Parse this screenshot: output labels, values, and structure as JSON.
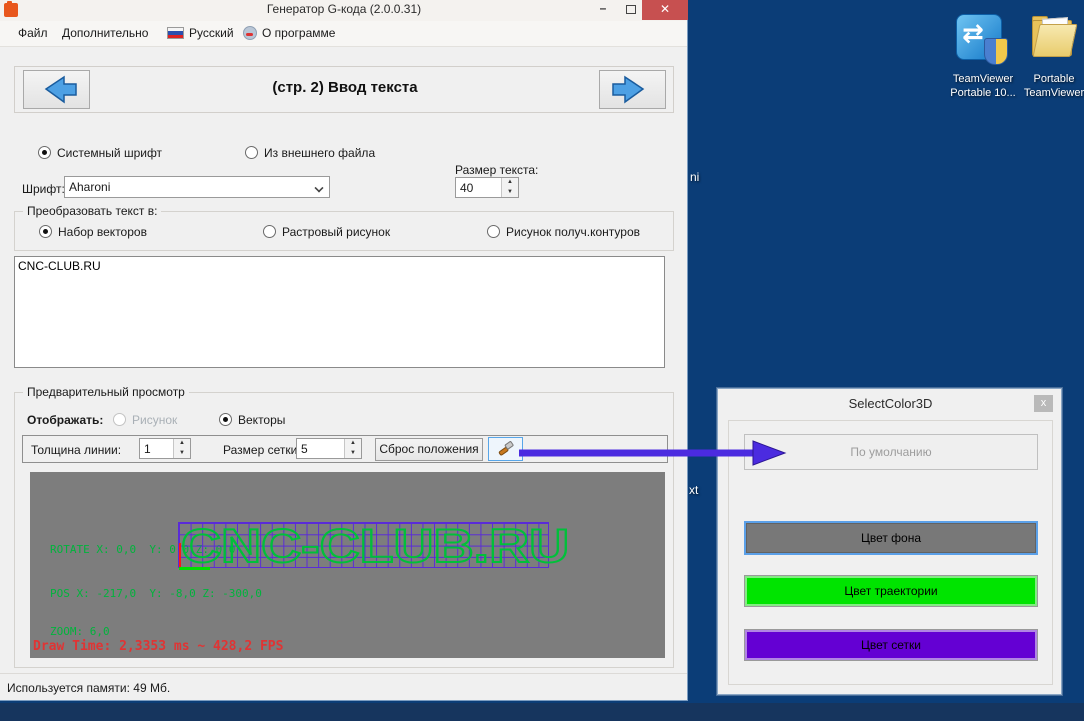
{
  "app": {
    "title": "Генератор G-кода (2.0.0.31)",
    "controls": {
      "minimize": "–",
      "close": "✕"
    }
  },
  "menu": {
    "items": [
      {
        "label": "Файл"
      },
      {
        "label": "Дополнительно"
      },
      {
        "label": "Русский"
      },
      {
        "label": "О программе"
      }
    ]
  },
  "nav": {
    "page_title": "(стр. 2) Ввод текста"
  },
  "font_section": {
    "radio_system": "Системный шрифт",
    "radio_external": "Из внешнего файла",
    "font_label": "Шрифт:",
    "font_value": "Aharoni",
    "size_label": "Размер текста:",
    "size_value": "40"
  },
  "convert_group": {
    "title": "Преобразовать текст в:",
    "option_vectors": "Набор векторов",
    "option_raster": "Растровый рисунок",
    "option_contours": "Рисунок получ.контуров"
  },
  "text_input": {
    "value": "CNC-CLUB.RU"
  },
  "preview": {
    "group_title": "Предварительный просмотр",
    "display_label": "Отображать:",
    "radio_picture": "Рисунок",
    "radio_vectors": "Векторы",
    "line_width_label": "Толщина линии:",
    "line_width_value": "1",
    "grid_size_label": "Размер сетки:",
    "grid_size_value": "5",
    "reset_button": "Сброс положения",
    "canvas": {
      "rotate_text": "ROTATE X: 0,0  Y: 0,0 Z: 0,0",
      "pos_text": "POS X: -217,0  Y: -8,0 Z: -300,0",
      "zoom_text": "ZOOM: 6,0",
      "draw_time_text": "Draw Time: 2,3353 ms ~ 428,2 FPS",
      "vector_text": "CNC-CLUB.RU",
      "bg_color": "#7d7d7d",
      "grid_color": "#5a2bd8",
      "trajectory_color": "#00c03a",
      "info_color": "#00b43c",
      "draw_time_color": "#e03434"
    }
  },
  "status": {
    "memory_text": "Используется памяти:  49  Мб."
  },
  "dialog": {
    "title": "SelectColor3D",
    "close": "x",
    "default_button": "По умолчанию",
    "buttons": [
      {
        "label": "Цвет фона",
        "color": "#787878"
      },
      {
        "label": "Цвет траектории",
        "color": "#00e400"
      },
      {
        "label": "Цвет сетки",
        "color": "#6400d3"
      }
    ]
  },
  "pointer": {
    "arrow_color": "#4b2be0"
  },
  "desktop": {
    "bg_color": "#0b3d77",
    "taskbar_color": "#16355e",
    "icons": [
      {
        "label_line1": "TeamViewer",
        "label_line2": "Portable 10..."
      },
      {
        "label_line1": "Portable",
        "label_line2": "TeamViewer"
      }
    ],
    "fragments": {
      "top": "ni",
      "bottom": "xt"
    }
  }
}
